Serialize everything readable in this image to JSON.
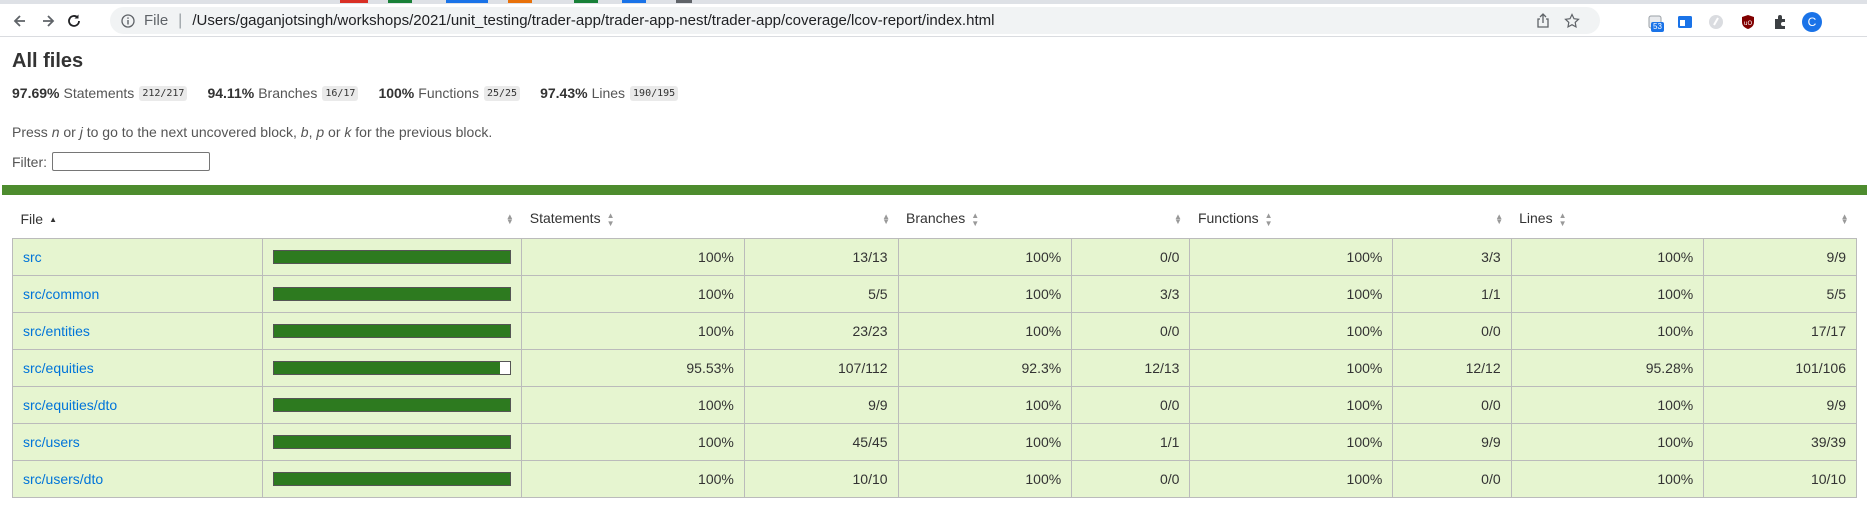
{
  "browser": {
    "scheme": "File",
    "url": "/Users/gaganjotsingh/workshops/2021/unit_testing/trader-app/trader-app-nest/trader-app/coverage/lcov-report/index.html",
    "ext_badge": "53",
    "profile_initial": "C"
  },
  "report": {
    "title": "All files",
    "summary": [
      {
        "pct": "97.69%",
        "label": "Statements",
        "fraction": "212/217"
      },
      {
        "pct": "94.11%",
        "label": "Branches",
        "fraction": "16/17"
      },
      {
        "pct": "100%",
        "label": "Functions",
        "fraction": "25/25"
      },
      {
        "pct": "97.43%",
        "label": "Lines",
        "fraction": "190/195"
      }
    ],
    "hint": {
      "p1": "Press ",
      "k1": "n",
      "p2": " or ",
      "k2": "j",
      "p3": " to go to the next uncovered block, ",
      "k3": "b",
      "p4": ", ",
      "k4": "p",
      "p5": " or ",
      "k5": "k",
      "p6": " for the previous block."
    },
    "filter_label": "Filter:",
    "filter_value": ""
  },
  "table": {
    "headers": {
      "file": "File",
      "statements": "Statements",
      "branches": "Branches",
      "functions": "Functions",
      "lines": "Lines"
    },
    "rows": [
      {
        "file": "src",
        "coverage": 1.0,
        "stmt_pct": "100%",
        "stmt_frac": "13/13",
        "br_pct": "100%",
        "br_frac": "0/0",
        "fn_pct": "100%",
        "fn_frac": "3/3",
        "ln_pct": "100%",
        "ln_frac": "9/9"
      },
      {
        "file": "src/common",
        "coverage": 1.0,
        "stmt_pct": "100%",
        "stmt_frac": "5/5",
        "br_pct": "100%",
        "br_frac": "3/3",
        "fn_pct": "100%",
        "fn_frac": "1/1",
        "ln_pct": "100%",
        "ln_frac": "5/5"
      },
      {
        "file": "src/entities",
        "coverage": 1.0,
        "stmt_pct": "100%",
        "stmt_frac": "23/23",
        "br_pct": "100%",
        "br_frac": "0/0",
        "fn_pct": "100%",
        "fn_frac": "0/0",
        "ln_pct": "100%",
        "ln_frac": "17/17"
      },
      {
        "file": "src/equities",
        "coverage": 0.9553,
        "stmt_pct": "95.53%",
        "stmt_frac": "107/112",
        "br_pct": "92.3%",
        "br_frac": "12/13",
        "fn_pct": "100%",
        "fn_frac": "12/12",
        "ln_pct": "95.28%",
        "ln_frac": "101/106"
      },
      {
        "file": "src/equities/dto",
        "coverage": 1.0,
        "stmt_pct": "100%",
        "stmt_frac": "9/9",
        "br_pct": "100%",
        "br_frac": "0/0",
        "fn_pct": "100%",
        "fn_frac": "0/0",
        "ln_pct": "100%",
        "ln_frac": "9/9"
      },
      {
        "file": "src/users",
        "coverage": 1.0,
        "stmt_pct": "100%",
        "stmt_frac": "45/45",
        "br_pct": "100%",
        "br_frac": "1/1",
        "fn_pct": "100%",
        "fn_frac": "9/9",
        "ln_pct": "100%",
        "ln_frac": "39/39"
      },
      {
        "file": "src/users/dto",
        "coverage": 1.0,
        "stmt_pct": "100%",
        "stmt_frac": "10/10",
        "br_pct": "100%",
        "br_frac": "0/0",
        "fn_pct": "100%",
        "fn_frac": "0/0",
        "ln_pct": "100%",
        "ln_frac": "10/10"
      }
    ]
  },
  "colors": {
    "high_bg": "#e6f5d0",
    "status_line": "#4d8c2e",
    "bar_fill": "#2d7a1f",
    "link": "#0074d9"
  },
  "icons": [
    "back-arrow-icon",
    "forward-arrow-icon",
    "reload-icon",
    "info-icon",
    "share-icon",
    "star-icon",
    "puzzle-icon"
  ]
}
